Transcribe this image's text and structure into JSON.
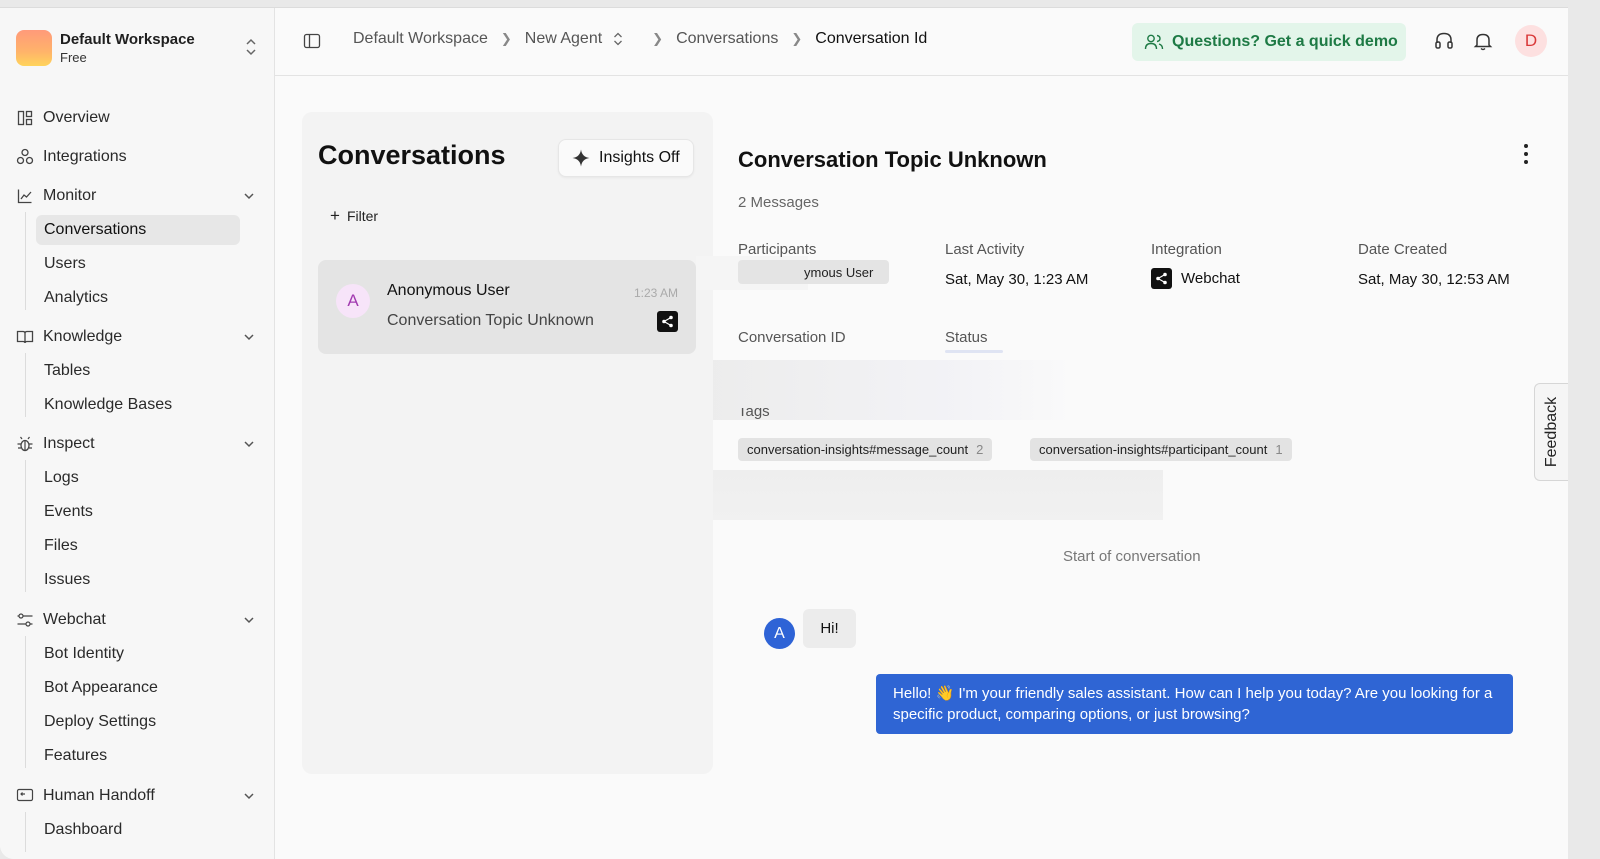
{
  "workspace": {
    "name": "Default Workspace",
    "plan": "Free"
  },
  "sidebar": {
    "overview": "Overview",
    "integrations": "Integrations",
    "monitor": "Monitor",
    "monitor_items": [
      "Conversations",
      "Users",
      "Analytics"
    ],
    "knowledge": "Knowledge",
    "knowledge_items": [
      "Tables",
      "Knowledge Bases"
    ],
    "inspect": "Inspect",
    "inspect_items": [
      "Logs",
      "Events",
      "Files",
      "Issues"
    ],
    "webchat": "Webchat",
    "webchat_items": [
      "Bot Identity",
      "Bot Appearance",
      "Deploy Settings",
      "Features"
    ],
    "handoff": "Human Handoff",
    "handoff_items": [
      "Dashboard"
    ]
  },
  "breadcrumb": [
    "Default Workspace",
    "New Agent",
    "Conversations",
    "Conversation Id"
  ],
  "header": {
    "demo_label": "Questions? Get a quick demo",
    "avatar_letter": "D"
  },
  "conversations": {
    "title": "Conversations",
    "insights_label": "Insights Off",
    "filter_label": "Filter",
    "items": [
      {
        "avatar": "A",
        "name": "Anonymous User",
        "time": "1:23 AM",
        "topic": "Conversation Topic Unknown"
      }
    ]
  },
  "detail": {
    "title": "Conversation Topic Unknown",
    "message_count": "2 Messages",
    "participants_label": "Participants",
    "participant_value": "ymous User",
    "last_activity_label": "Last Activity",
    "last_activity_value": "Sat, May 30, 1:23 AM",
    "integration_label": "Integration",
    "integration_value": "Webchat",
    "date_created_label": "Date Created",
    "date_created_value": "Sat, May 30, 12:53 AM",
    "conversation_id_label": "Conversation ID",
    "status_label": "Status",
    "tags_label": "Tags",
    "tags": [
      {
        "name": "conversation-insights#message_count",
        "count": "2"
      },
      {
        "name": "conversation-insights#participant_count",
        "count": "1"
      }
    ],
    "start_label": "Start of conversation",
    "user_avatar": "A",
    "user_message": "Hi!",
    "bot_message": "Hello! 👋 I'm your friendly sales assistant. How can I help you today? Are you looking for a specific product, comparing options, or just browsing?"
  },
  "feedback_label": "Feedback",
  "colors": {
    "accent": "#2f65d4",
    "demo_bg": "#e3f5ea",
    "demo_text": "#1e7a45"
  }
}
